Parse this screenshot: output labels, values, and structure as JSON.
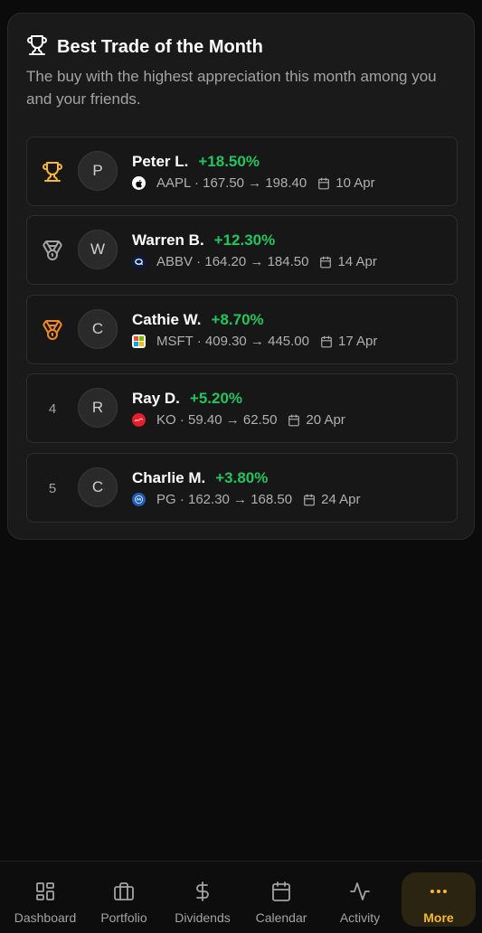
{
  "card": {
    "title": "Best Trade of the Month",
    "subtitle": "The buy with the highest appreciation this month among you and your friends."
  },
  "trades": [
    {
      "rank": "",
      "rank_icon": "trophy-icon",
      "initial": "P",
      "name": "Peter L.",
      "change": "+18.50%",
      "ticker_logo": "apple-logo",
      "detail": "AAPL · 167.50 → 198.40",
      "date": "10 Apr"
    },
    {
      "rank": "",
      "rank_icon": "silver-medal-icon",
      "initial": "W",
      "name": "Warren B.",
      "change": "+12.30%",
      "ticker_logo": "abbvie-logo",
      "detail": "ABBV · 164.20 → 184.50",
      "date": "14 Apr"
    },
    {
      "rank": "",
      "rank_icon": "bronze-medal-icon",
      "initial": "C",
      "name": "Cathie W.",
      "change": "+8.70%",
      "ticker_logo": "microsoft-logo",
      "detail": "MSFT · 409.30 → 445.00",
      "date": "17 Apr"
    },
    {
      "rank": "4",
      "rank_icon": "",
      "initial": "R",
      "name": "Ray D.",
      "change": "+5.20%",
      "ticker_logo": "coca-cola-logo",
      "detail": "KO · 59.40 → 62.50",
      "date": "20 Apr"
    },
    {
      "rank": "5",
      "rank_icon": "",
      "initial": "C",
      "name": "Charlie M.",
      "change": "+3.80%",
      "ticker_logo": "pg-logo",
      "detail": "PG · 162.30 → 168.50",
      "date": "24 Apr"
    }
  ],
  "nav": {
    "items": [
      {
        "label": "Dashboard",
        "icon": "dashboard-icon"
      },
      {
        "label": "Portfolio",
        "icon": "briefcase-icon"
      },
      {
        "label": "Dividends",
        "icon": "dollar-icon"
      },
      {
        "label": "Calendar",
        "icon": "calendar-icon"
      },
      {
        "label": "Activity",
        "icon": "activity-icon"
      },
      {
        "label": "More",
        "icon": "more-icon",
        "active": true
      }
    ]
  },
  "colors": {
    "positive": "#22c55e",
    "gold": "#f5b82e",
    "silver": "#a3a3a3",
    "bronze": "#f08a24"
  }
}
